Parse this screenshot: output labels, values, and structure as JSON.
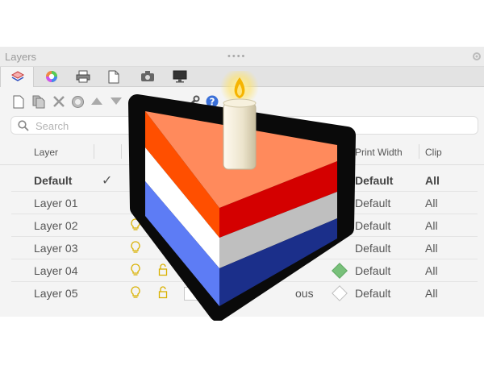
{
  "panel": {
    "title": "Layers",
    "drag_handle": "••••"
  },
  "tabs": [
    {
      "icon": "layers-icon",
      "active": true
    },
    {
      "icon": "color-wheel-icon"
    },
    {
      "icon": "printer-icon"
    },
    {
      "icon": "document-icon"
    },
    {
      "icon": "camera-icon"
    },
    {
      "icon": "monitor-icon"
    }
  ],
  "toolbar": {
    "icons": [
      "new-layer-icon",
      "new-sublayer-icon",
      "delete-icon",
      "filter-icon",
      "move-up-icon",
      "move-down-icon",
      "wrench-icon",
      "help-icon"
    ]
  },
  "search": {
    "placeholder": "Search",
    "value": ""
  },
  "table": {
    "headers": {
      "layer": "Layer",
      "print_width": "Print Width",
      "clip": "Clip"
    },
    "current_mark": "✓",
    "rows": [
      {
        "name": "Default",
        "print_width": "Default",
        "clip": "All",
        "current": true
      },
      {
        "name": "Layer 01",
        "print_width": "Default",
        "clip": "All"
      },
      {
        "name": "Layer 02",
        "print_width": "Default",
        "clip": "All"
      },
      {
        "name": "Layer 03",
        "print_width": "Default",
        "clip": "All"
      },
      {
        "name": "Layer 04",
        "print_width": "Default",
        "clip": "All"
      },
      {
        "name": "Layer 05",
        "print_width": "Default",
        "clip": "All",
        "linetype_partial": "ous"
      }
    ]
  },
  "overlay": {
    "icon": "birthday-cake-icon",
    "colors": [
      "#ff4f00",
      "#ffffff",
      "#5d7cf5",
      "#d40000",
      "#bfbfbf",
      "#1b2f8a"
    ]
  }
}
